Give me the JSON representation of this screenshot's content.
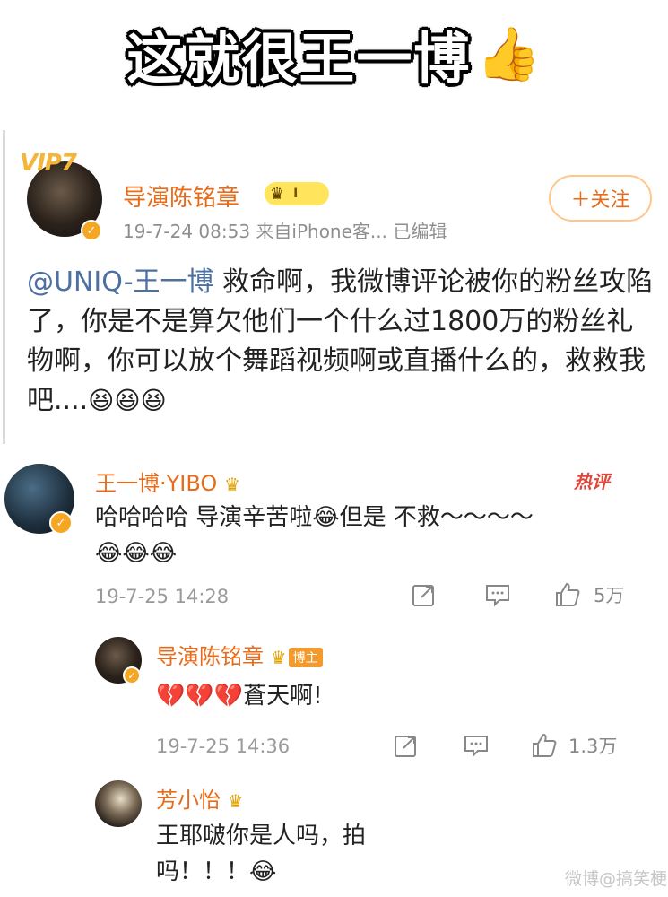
{
  "headline": {
    "text": "这就很王一博",
    "emoji": "👍"
  },
  "post": {
    "vip_label": "VIP7",
    "author": "导演陈铭章",
    "level_badge": "I",
    "meta": "19-7-24 08:53  来自iPhone客...  已编辑",
    "follow_label": "＋关注",
    "mention": "@UNIQ-王一博",
    "body": " 救命啊，我微博评论被你的粉丝攻陷了，你是不是算欠他们一个什么过1800万的粉丝礼物啊，你可以放个舞蹈视频啊或直播什么的，救救我吧....",
    "emojis": "😆😆😆"
  },
  "comments": [
    {
      "author": "王一博·YIBO",
      "hot_label": "热评",
      "text_line1": "哈哈哈哈 导演辛苦啦😂但是 不救～～～～",
      "text_line2": "😂😂😂",
      "time": "19-7-25 14:28",
      "likes": "5万"
    },
    {
      "author": "导演陈铭章",
      "owner_tag": "博主",
      "text": "💔💔💔蒼天啊!",
      "time": "19-7-25 14:36",
      "likes": "1.3万"
    },
    {
      "author": "芳小怡",
      "text_line1": "王耶啵你是人吗，拍",
      "text_line2": "吗！！！😂"
    }
  ],
  "watermark": "微博@搞笑梗主",
  "colors": {
    "name_orange": "#e86b1a",
    "mention_blue": "#4d6fa1",
    "hot_red": "#e0453a"
  }
}
